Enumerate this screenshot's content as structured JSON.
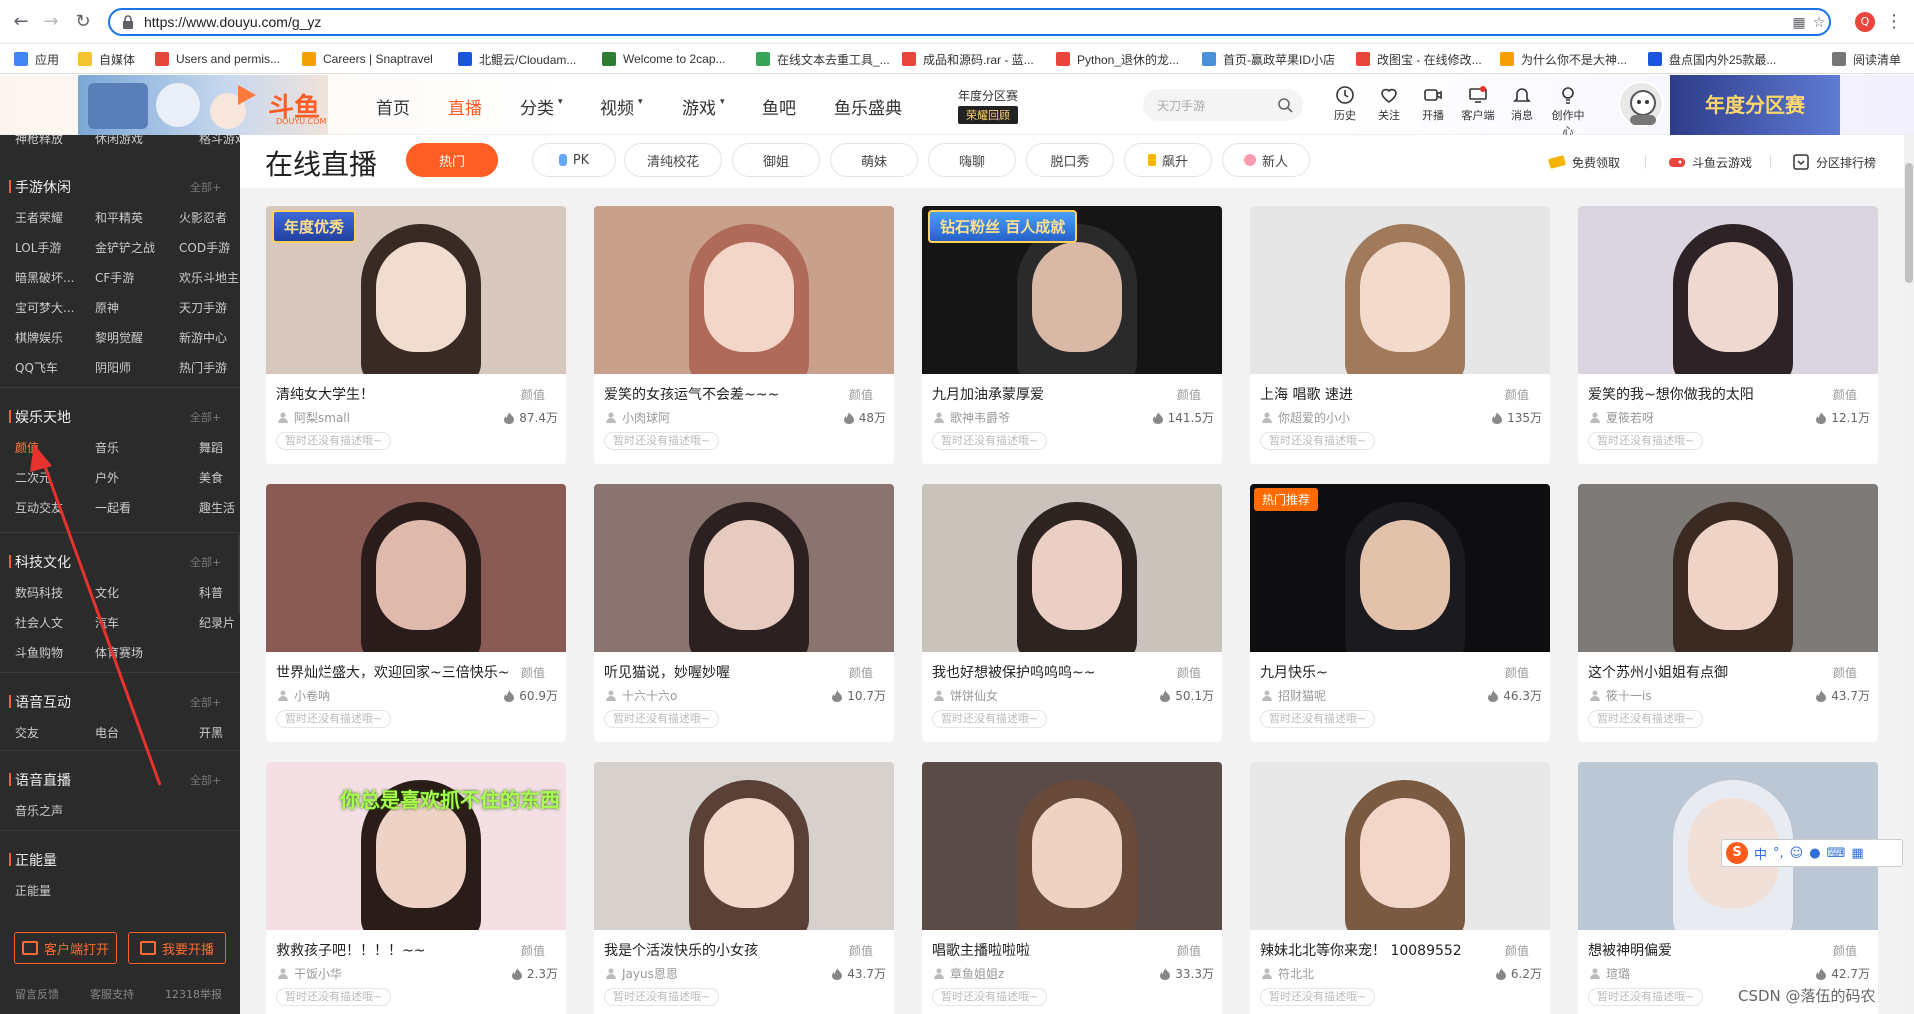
{
  "browser": {
    "url": "https://www.douyu.com/g_yz",
    "profile_letter": "Q",
    "bookmarks": [
      {
        "label": "应用",
        "color": "#4285f4"
      },
      {
        "label": "自媒体",
        "color": "#f4c430"
      },
      {
        "label": "Users and permis...",
        "color": "#e8453c"
      },
      {
        "label": "Careers | Snaptravel",
        "color": "#f4a000"
      },
      {
        "label": "北鲲云/Cloudam...",
        "color": "#1a56db"
      },
      {
        "label": "Welcome to 2cap...",
        "color": "#2e7d32"
      },
      {
        "label": "在线文本去重工具_...",
        "color": "#3aa35a"
      },
      {
        "label": "成品和源码.rar - 蓝...",
        "color": "#e8453c"
      },
      {
        "label": "Python_退休的龙...",
        "color": "#e8453c"
      },
      {
        "label": "首页-赢政苹果ID小店",
        "color": "#4a90d9"
      },
      {
        "label": "改图宝 - 在线修改...",
        "color": "#e8453c"
      },
      {
        "label": "为什么你不是大神...",
        "color": "#f4a000"
      },
      {
        "label": "盘点国内外25款最...",
        "color": "#1a56db"
      },
      {
        "label": "阅读清单",
        "color": "#777777"
      }
    ]
  },
  "header": {
    "logo": "斗鱼",
    "logo_sub": "DOUYU.COM",
    "nav": [
      {
        "label": "首页",
        "active": false
      },
      {
        "label": "直播",
        "active": true
      },
      {
        "label": "分类",
        "active": false
      },
      {
        "label": "视频",
        "active": false
      },
      {
        "label": "游戏",
        "active": false
      },
      {
        "label": "鱼吧",
        "active": false
      },
      {
        "label": "鱼乐盛典",
        "active": false
      }
    ],
    "year_title": "年度分区赛",
    "year_sub": "荣耀回顾",
    "search_placeholder": "天刀手游",
    "tools": [
      {
        "label": "历史",
        "icon": "clock-icon"
      },
      {
        "label": "关注",
        "icon": "heart-icon"
      },
      {
        "label": "开播",
        "icon": "camera-icon"
      },
      {
        "label": "客户端",
        "icon": "monitor-icon"
      },
      {
        "label": "消息",
        "icon": "bell-icon"
      },
      {
        "label": "创作中心",
        "icon": "bulb-icon"
      }
    ],
    "banner_text": "年度分区赛"
  },
  "sidebar": {
    "top_items": [
      "神枪释放",
      "休闲游戏",
      "格斗游戏"
    ],
    "sections": [
      {
        "title": "手游休闲",
        "all": "全部+",
        "rows": [
          [
            "王者荣耀",
            "和平精英",
            "火影忍者"
          ],
          [
            "LOL手游",
            "金铲铲之战",
            "COD手游"
          ],
          [
            "暗黑破坏...",
            "CF手游",
            "欢乐斗地主"
          ],
          [
            "宝可梦大...",
            "原神",
            "天刀手游"
          ],
          [
            "棋牌娱乐",
            "黎明觉醒",
            "新游中心"
          ],
          [
            "QQ飞车",
            "阴阳师",
            "热门手游"
          ]
        ]
      },
      {
        "title": "娱乐天地",
        "all": "全部+",
        "rows": [
          [
            "颜值",
            "音乐",
            "舞蹈"
          ],
          [
            "二次元",
            "户外",
            "美食"
          ],
          [
            "互动交友",
            "一起看",
            "趣生活"
          ]
        ]
      },
      {
        "title": "科技文化",
        "all": "全部+",
        "rows": [
          [
            "数码科技",
            "文化",
            "科普"
          ],
          [
            "社会人文",
            "汽车",
            "纪录片"
          ],
          [
            "斗鱼购物",
            "体育赛场",
            ""
          ]
        ]
      },
      {
        "title": "语音互动",
        "all": "全部+",
        "rows": [
          [
            "交友",
            "电台",
            "开黑"
          ]
        ]
      },
      {
        "title": "语音直播",
        "all": "全部+",
        "rows": [
          [
            "音乐之声",
            "",
            ""
          ]
        ]
      },
      {
        "title": "正能量",
        "all": "",
        "rows": [
          [
            "正能量",
            "",
            ""
          ]
        ]
      }
    ],
    "open_client": "客户端打开",
    "start_stream": "我要开播",
    "footer": [
      "留言反馈",
      "客服支持",
      "12318举报"
    ]
  },
  "main": {
    "title": "在线直播",
    "chips": [
      {
        "label": "热门",
        "active": true
      },
      {
        "label": "PK",
        "active": false
      },
      {
        "label": "清纯校花",
        "active": false
      },
      {
        "label": "御姐",
        "active": false
      },
      {
        "label": "萌妹",
        "active": false
      },
      {
        "label": "嗨聊",
        "active": false
      },
      {
        "label": "脱口秀",
        "active": false
      },
      {
        "label": "飙升",
        "active": false
      },
      {
        "label": "新人",
        "active": false
      }
    ],
    "links": [
      "免费领取",
      "斗鱼云游戏",
      "分区排行榜"
    ],
    "desc_placeholder": "暂时还没有描述哦~",
    "cards": [
      {
        "title": "清纯女大学生！",
        "cat": "颜值",
        "streamer": "阿梨small",
        "hot": "87.4万",
        "badge": "年度优秀"
      },
      {
        "title": "爱笑的女孩运气不会差~~~",
        "cat": "颜值",
        "streamer": "小肉球阿",
        "hot": "48万",
        "badge": ""
      },
      {
        "title": "九月加油承蒙厚爱",
        "cat": "颜值",
        "streamer": "歌神韦爵爷",
        "hot": "141.5万",
        "badge": "钻石粉丝 百人成就"
      },
      {
        "title": "上海 唱歌 速进",
        "cat": "颜值",
        "streamer": "你超爱的小小",
        "hot": "135万",
        "badge": ""
      },
      {
        "title": "爱笑的我~想你做我的太阳",
        "cat": "颜值",
        "streamer": "夏筱若呀",
        "hot": "12.1万",
        "badge": ""
      },
      {
        "title": "世界灿烂盛大，欢迎回家~三倍快乐~",
        "cat": "颜值",
        "streamer": "小卷呐",
        "hot": "60.9万",
        "badge": ""
      },
      {
        "title": "听见猫说，妙喔妙喔",
        "cat": "颜值",
        "streamer": "十六十六o",
        "hot": "10.7万",
        "badge": ""
      },
      {
        "title": "我也好想被保护呜呜呜~~",
        "cat": "颜值",
        "streamer": "饼饼仙女",
        "hot": "50.1万",
        "badge": ""
      },
      {
        "title": "九月快乐~",
        "cat": "颜值",
        "streamer": "招财猫呢",
        "hot": "46.3万",
        "badge": "热门推荐"
      },
      {
        "title": "这个苏州小姐姐有点御",
        "cat": "颜值",
        "streamer": "筱十一is",
        "hot": "43.7万",
        "badge": ""
      },
      {
        "title": "救救孩子吧！！！！~~",
        "cat": "颜值",
        "streamer": "干饭小华",
        "hot": "2.3万",
        "badge": "你总是喜欢抓不住的东西"
      },
      {
        "title": "我是个活泼快乐的小女孩",
        "cat": "颜值",
        "streamer": "Jayus恩恩",
        "hot": "43.7万",
        "badge": ""
      },
      {
        "title": "唱歌主播啦啦啦",
        "cat": "颜值",
        "streamer": "章鱼姐姐z",
        "hot": "33.3万",
        "badge": ""
      },
      {
        "title": "辣妹北北等你来宠！ 10089552",
        "cat": "颜值",
        "streamer": "符北北",
        "hot": "6.2万",
        "badge": ""
      },
      {
        "title": "想被神明偏爱",
        "cat": "颜值",
        "streamer": "瑄璐",
        "hot": "42.7万",
        "badge": ""
      }
    ]
  },
  "overlay": {
    "ime_label": "中",
    "watermark": "CSDN @落伍的码农"
  }
}
